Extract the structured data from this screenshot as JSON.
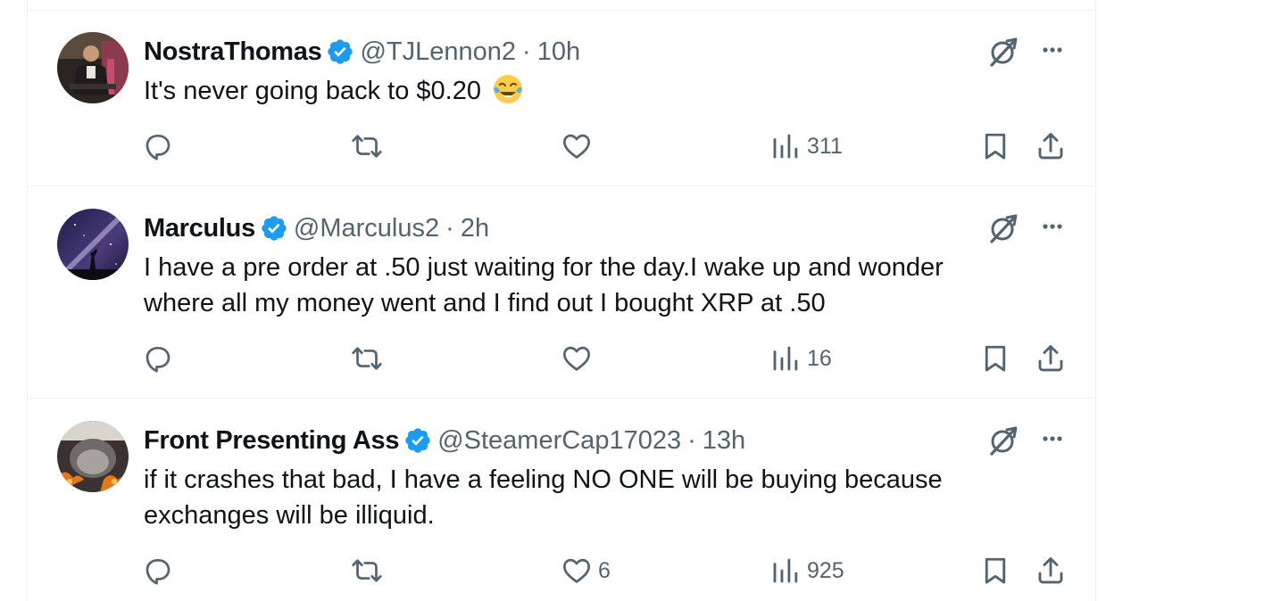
{
  "tweets": [
    {
      "name": "NostraThomas",
      "handle": "@TJLennon2",
      "separator": "·",
      "time": "10h",
      "text": "It's never going back to $0.20",
      "emoji": "face-with-tears-of-joy",
      "reply_count": "",
      "retweet_count": "",
      "like_count": "",
      "views_count": "311"
    },
    {
      "name": "Marculus",
      "handle": "@Marculus2",
      "separator": "·",
      "time": "2h",
      "text": "I have a pre order at .50 just waiting for the day.I wake up and wonder where all my money went and I find out I bought XRP at .50",
      "reply_count": "",
      "retweet_count": "",
      "like_count": "",
      "views_count": "16"
    },
    {
      "name": "Front Presenting Ass",
      "handle": "@SteamerCap17023",
      "separator": "·",
      "time": "13h",
      "text": "if it crashes that bad, I have a feeling NO ONE will be buying because exchanges will be illiquid.",
      "reply_count": "",
      "retweet_count": "",
      "like_count": "6",
      "views_count": "925"
    }
  ],
  "colors": {
    "verified_badge": "#1d9bf0",
    "secondary_text": "#536471",
    "primary_text": "#0f1419",
    "divider": "#eff3f4"
  },
  "icons": {
    "verified": "verified-badge-icon",
    "grok": "grok-icon",
    "more": "more-icon",
    "reply": "reply-icon",
    "retweet": "retweet-icon",
    "like": "like-icon",
    "views": "views-icon",
    "bookmark": "bookmark-icon",
    "share": "share-icon"
  }
}
